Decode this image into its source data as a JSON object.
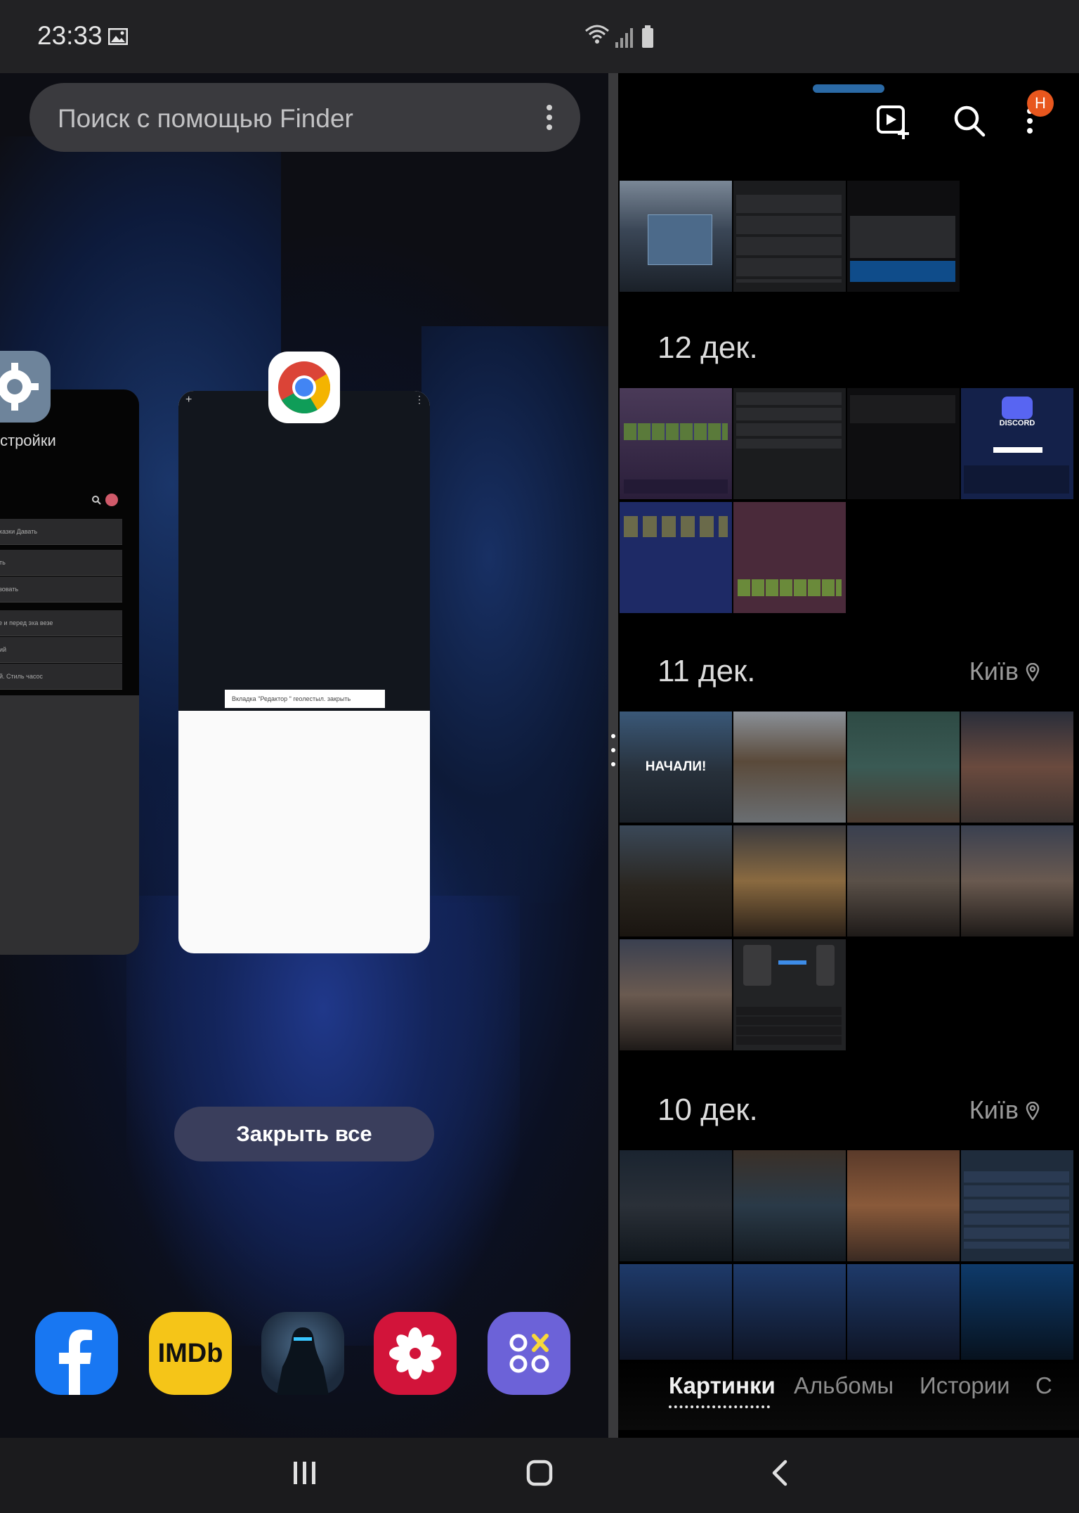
{
  "status_bar": {
    "time": "23:33"
  },
  "recents": {
    "search_placeholder": "Поиск с помощью Finder",
    "settings_card": {
      "title": "стройки",
      "rows": [
        "еказки Давать",
        "ить",
        "ьзовать",
        "ке и перед эха везе",
        "ний",
        "ой. Стиль часос"
      ]
    },
    "chrome_card": {
      "snackbar": "Вкладка \"Редактор \" геолестыл. закрыть"
    },
    "close_all_label": "Закрыть все",
    "dock": [
      {
        "name": "facebook",
        "label": "f",
        "color": "#1877f2"
      },
      {
        "name": "imdb",
        "label": "IMDb",
        "color": "#f5c518"
      },
      {
        "name": "shadow-game",
        "label": "",
        "color": "#2d3d52"
      },
      {
        "name": "flower-app",
        "label": "",
        "color": "#d2143a"
      },
      {
        "name": "game-launcher",
        "label": "",
        "color": "#6c62d8"
      }
    ]
  },
  "gallery": {
    "badge": "Н",
    "sections": [
      {
        "date": "12 дек.",
        "location": ""
      },
      {
        "date": "11 дек.",
        "location": "Київ"
      },
      {
        "date": "10 дек.",
        "location": "Київ"
      }
    ],
    "thumb_texts": {
      "nachali": "НАЧАЛИ!",
      "discord": "DISCORD"
    },
    "tabs": [
      "Картинки",
      "Альбомы",
      "Истории",
      "С"
    ]
  },
  "colors": {
    "accent_blue": "#2b6aa6",
    "badge_orange": "#e8571e"
  }
}
